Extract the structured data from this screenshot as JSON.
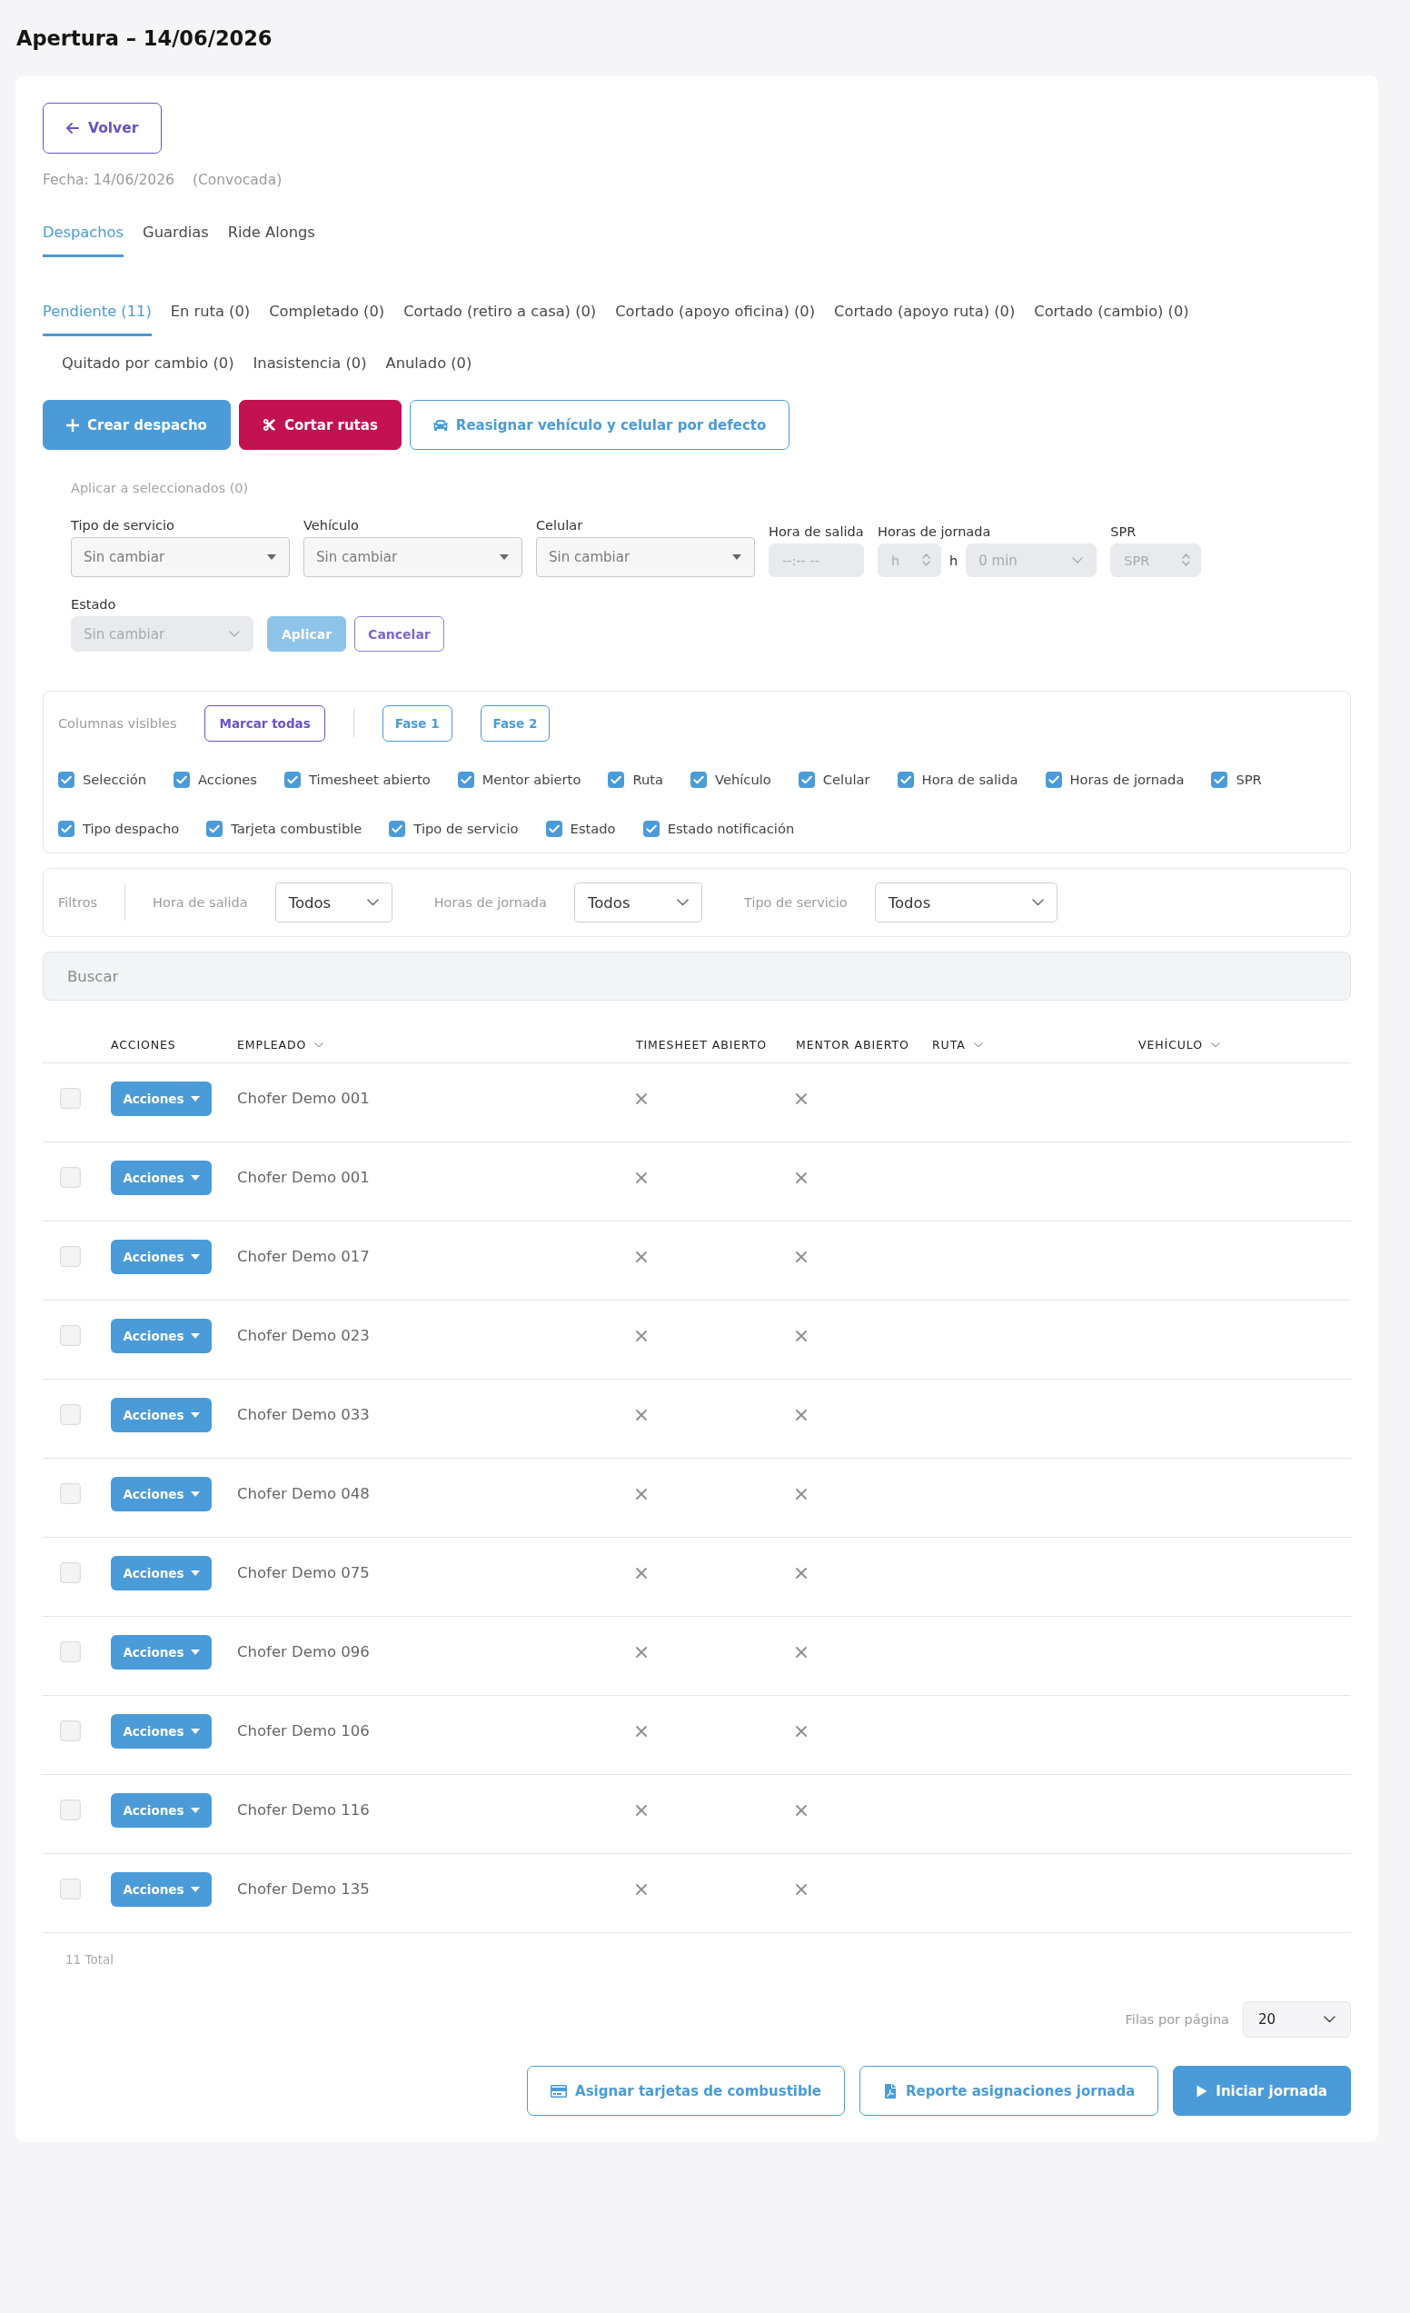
{
  "page": {
    "title": "Apertura – 14/06/2026"
  },
  "back_button": {
    "label": "Volver"
  },
  "meta": {
    "date": "Fecha: 14/06/2026",
    "status": "(Convocada)"
  },
  "section_tabs": [
    {
      "label": "Despachos",
      "selected": true
    },
    {
      "label": "Guardias",
      "selected": false
    },
    {
      "label": "Ride Alongs",
      "selected": false
    }
  ],
  "status_tabs": [
    {
      "label": "Pendiente (11)",
      "selected": true
    },
    {
      "label": "En ruta (0)",
      "selected": false
    },
    {
      "label": "Completado (0)",
      "selected": false
    },
    {
      "label": "Cortado (retiro a casa) (0)",
      "selected": false
    },
    {
      "label": "Cortado (apoyo oficina) (0)",
      "selected": false
    },
    {
      "label": "Cortado (apoyo ruta) (0)",
      "selected": false
    },
    {
      "label": "Cortado (cambio) (0)",
      "selected": false
    },
    {
      "label": "Quitado por cambio (0)",
      "selected": false
    },
    {
      "label": "Inasistencia (0)",
      "selected": false
    },
    {
      "label": "Anulado (0)",
      "selected": false
    }
  ],
  "actions": [
    {
      "label": "Crear despacho",
      "kind": "filled"
    },
    {
      "label": "Cortar rutas",
      "kind": "danger"
    },
    {
      "label": "Reasignar vehículo y celular por defecto",
      "kind": "outline"
    }
  ],
  "bulk_edit": {
    "caption": "Aplicar a seleccionados (0)",
    "fields": [
      {
        "kind": "select",
        "label": "Tipo de servicio",
        "value": "Sin cambiar",
        "disabled": false
      },
      {
        "kind": "select",
        "label": "Vehículo",
        "value": "Sin cambiar",
        "disabled": false
      },
      {
        "kind": "select",
        "label": "Celular",
        "value": "Sin cambiar",
        "disabled": false
      },
      {
        "kind": "time",
        "label": "Hora de salida",
        "placeholder": "--:-- --",
        "disabled": true
      },
      {
        "kind": "duration",
        "label": "Horas de jornada",
        "placeholder": "h",
        "unit": "h",
        "minutes": "0 min",
        "disabled": true
      },
      {
        "kind": "number",
        "label": "SPR",
        "placeholder": "SPR",
        "disabled": true
      }
    ],
    "status_field": {
      "label": "Estado",
      "value": "Sin cambiar",
      "disabled": true
    },
    "apply_button": {
      "label": "Aplicar",
      "disabled": true
    },
    "cancel_button": {
      "label": "Cancelar"
    }
  },
  "column_picker": {
    "label": "Columnas visibles",
    "mark_all_button": "Marcar todas",
    "presets": [
      {
        "label": "Fase 1"
      },
      {
        "label": "Fase 2"
      }
    ],
    "columns": [
      {
        "label": "Selección",
        "checked": true
      },
      {
        "label": "Acciones",
        "checked": true
      },
      {
        "label": "Timesheet abierto",
        "checked": true
      },
      {
        "label": "Mentor abierto",
        "checked": true
      },
      {
        "label": "Ruta",
        "checked": true
      },
      {
        "label": "Vehículo",
        "checked": true
      },
      {
        "label": "Celular",
        "checked": true
      },
      {
        "label": "Hora de salida",
        "checked": true
      },
      {
        "label": "Horas de jornada",
        "checked": true
      },
      {
        "label": "SPR",
        "checked": true
      },
      {
        "label": "Tipo despacho",
        "checked": true
      },
      {
        "label": "Tarjeta combustible",
        "checked": true
      },
      {
        "label": "Tipo de servicio",
        "checked": true
      },
      {
        "label": "Estado",
        "checked": true
      },
      {
        "label": "Estado notificación",
        "checked": true
      }
    ]
  },
  "filters": {
    "label": "Filtros",
    "items": [
      {
        "label": "Hora de salida",
        "value": "Todos"
      },
      {
        "label": "Horas de jornada",
        "value": "Todos"
      },
      {
        "label": "Tipo de servicio",
        "value": "Todos"
      }
    ]
  },
  "search": {
    "placeholder": "Buscar"
  },
  "table": {
    "columns": [
      {
        "label": "ACCIONES",
        "sortable": false
      },
      {
        "label": "EMPLEADO",
        "sortable": true
      },
      {
        "label": "TIMESHEET ABIERTO",
        "sortable": false
      },
      {
        "label": "MENTOR ABIERTO",
        "sortable": false
      },
      {
        "label": "RUTA",
        "sortable": true
      },
      {
        "label": "VEHÍCULO",
        "sortable": true
      }
    ],
    "rows": [
      {
        "selected": false,
        "action_label": "Acciones",
        "employee": "Chofer Demo 001",
        "timesheet_open": false,
        "mentor_open": false
      },
      {
        "selected": false,
        "action_label": "Acciones",
        "employee": "Chofer Demo 001",
        "timesheet_open": false,
        "mentor_open": false
      },
      {
        "selected": false,
        "action_label": "Acciones",
        "employee": "Chofer Demo 017",
        "timesheet_open": false,
        "mentor_open": false
      },
      {
        "selected": false,
        "action_label": "Acciones",
        "employee": "Chofer Demo 023",
        "timesheet_open": false,
        "mentor_open": false
      },
      {
        "selected": false,
        "action_label": "Acciones",
        "employee": "Chofer Demo 033",
        "timesheet_open": false,
        "mentor_open": false
      },
      {
        "selected": false,
        "action_label": "Acciones",
        "employee": "Chofer Demo 048",
        "timesheet_open": false,
        "mentor_open": false
      },
      {
        "selected": false,
        "action_label": "Acciones",
        "employee": "Chofer Demo 075",
        "timesheet_open": false,
        "mentor_open": false
      },
      {
        "selected": false,
        "action_label": "Acciones",
        "employee": "Chofer Demo 096",
        "timesheet_open": false,
        "mentor_open": false
      },
      {
        "selected": false,
        "action_label": "Acciones",
        "employee": "Chofer Demo 106",
        "timesheet_open": false,
        "mentor_open": false
      },
      {
        "selected": false,
        "action_label": "Acciones",
        "employee": "Chofer Demo 116",
        "timesheet_open": false,
        "mentor_open": false
      },
      {
        "selected": false,
        "action_label": "Acciones",
        "employee": "Chofer Demo 135",
        "timesheet_open": false,
        "mentor_open": false
      }
    ]
  },
  "footer": {
    "total": "11 Total",
    "rows_per_page": {
      "label": "Filas por página",
      "value": "20"
    },
    "buttons": [
      {
        "label": "Asignar tarjetas de combustible",
        "kind": "outline"
      },
      {
        "label": "Reporte asignaciones jornada",
        "kind": "outline"
      },
      {
        "label": "Iniciar jornada",
        "kind": "filled"
      }
    ]
  }
}
